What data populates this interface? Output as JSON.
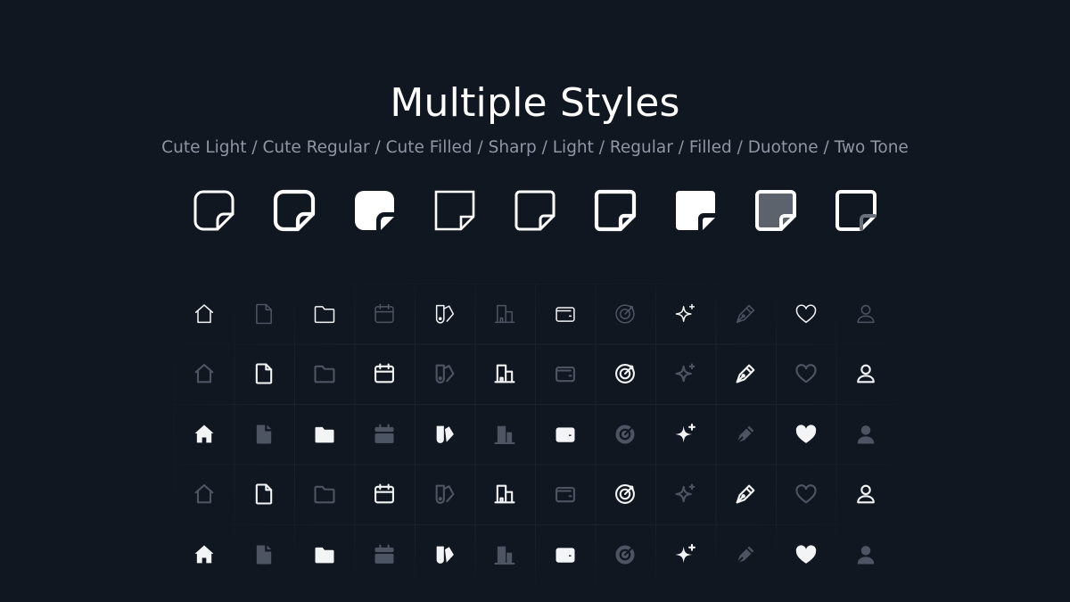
{
  "header": {
    "title": "Multiple Styles",
    "subtitle": "Cute Light / Cute Regular / Cute Filled / Sharp / Light / Regular / Filled / Duotone / Two Tone"
  },
  "style_showcase": {
    "icon": "sticky-note-icon",
    "variants": [
      "cute-light",
      "cute-regular",
      "cute-filled",
      "sharp",
      "light",
      "regular",
      "filled",
      "duotone",
      "two-tone"
    ]
  },
  "icon_grid": {
    "columns": [
      "home-icon",
      "file-icon",
      "folder-icon",
      "calendar-icon",
      "swatch-icon",
      "building-icon",
      "wallet-icon",
      "target-icon",
      "sparkle-icon",
      "pen-icon",
      "heart-icon",
      "user-icon"
    ],
    "rows": [
      {
        "style": "light",
        "emphasis": [
          "bright",
          "dim",
          "bright",
          "dim",
          "bright",
          "dim",
          "bright",
          "dim",
          "bright",
          "dim",
          "bright",
          "dim"
        ]
      },
      {
        "style": "regular",
        "emphasis": [
          "dim",
          "bright",
          "dim",
          "bright",
          "dim",
          "bright",
          "dim",
          "bright",
          "dim",
          "bright",
          "dim",
          "bright"
        ]
      },
      {
        "style": "filled",
        "emphasis": [
          "bright",
          "dim",
          "bright",
          "dim",
          "bright",
          "dim",
          "bright",
          "dim",
          "bright",
          "dim",
          "bright",
          "dim"
        ]
      },
      {
        "style": "regular",
        "emphasis": [
          "dim",
          "bright",
          "dim",
          "bright",
          "dim",
          "bright",
          "dim",
          "bright",
          "dim",
          "bright",
          "dim",
          "bright"
        ]
      },
      {
        "style": "filled",
        "emphasis": [
          "bright",
          "dim",
          "bright",
          "dim",
          "bright",
          "dim",
          "bright",
          "dim",
          "bright",
          "dim",
          "bright",
          "dim"
        ]
      }
    ]
  },
  "colors": {
    "background": "#111721",
    "bright": "#f3f4f6",
    "dim": "#4d5562",
    "subtitle": "#8e96a3"
  }
}
